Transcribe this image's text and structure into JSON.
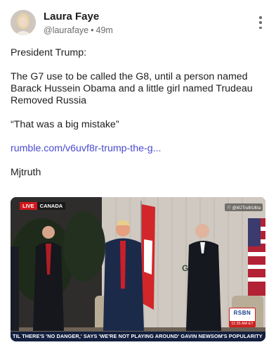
{
  "post": {
    "author_name": "Laura Faye",
    "handle": "@laurafaye",
    "separator": "•",
    "time_ago": "49m",
    "more_icon": "more-vertical-icon",
    "lines": {
      "l1": "President Trump:",
      "l2": "The G7 use to be called the G8, until a person named",
      "l3": "Barack Hussein Obama and a little girl named Trudeau",
      "l4": "Removed Russia",
      "l5": "“That was a big mistake”",
      "link": "rumble.com/v6uvf8r-trump-the-g...",
      "l6": "Mjtruth"
    }
  },
  "video": {
    "live_label": "LIVE",
    "live_location": "CANADA",
    "watermark": "ⓧ @MJTruthUltra",
    "network_logo": "RSBN",
    "network_time": "11:35 AM ET",
    "ticker_text": "TIL THERE'S 'NO DANGER,' SAYS 'WE'RE NOT PLAYING AROUND'   GAVIN NEWSOM'S POPULARITY",
    "colors": {
      "live_red": "#d0161b",
      "ticker_navy": "#13203f",
      "link": "#4a4ad0"
    }
  }
}
